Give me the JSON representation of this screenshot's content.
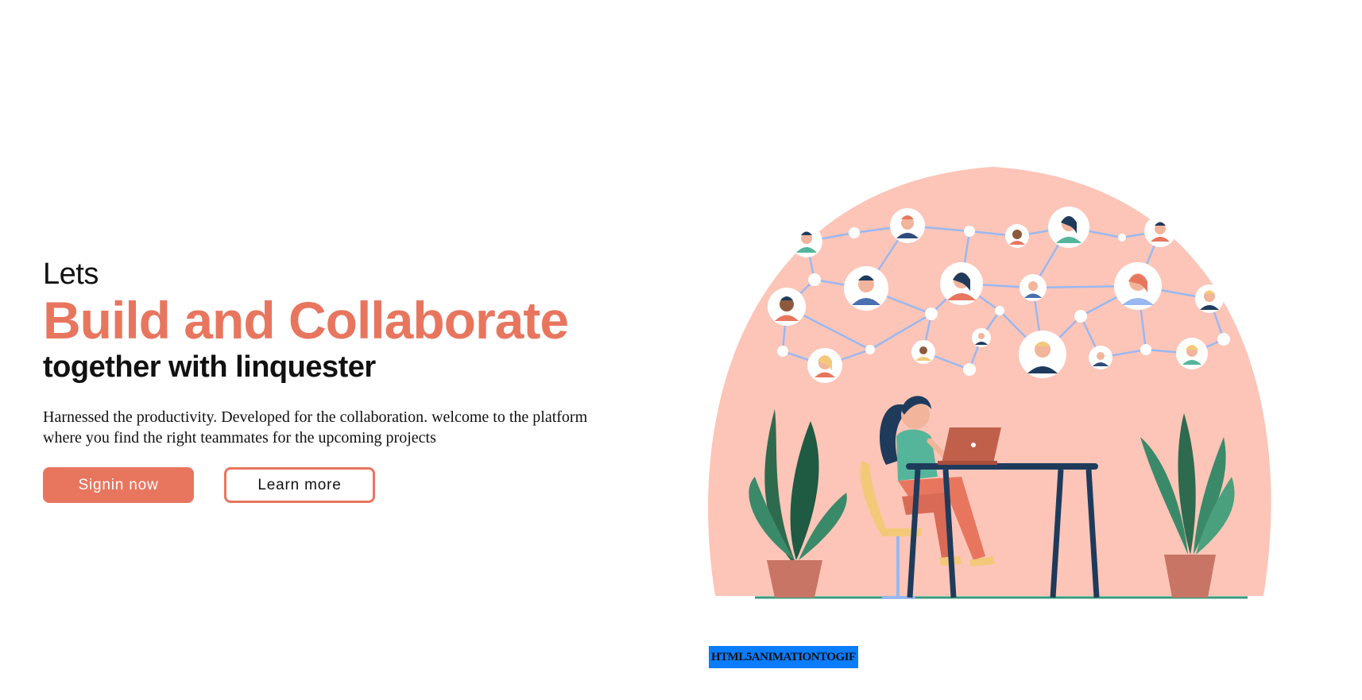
{
  "hero": {
    "heading_lets": "Lets",
    "heading_main": "Build and Collaborate",
    "heading_sub": "together with linquester",
    "description": "Harnessed the productivity. Developed for the collaboration. welcome to the platform where you find the right teammates for the upcoming projects",
    "signin_label": "Signin now",
    "learn_more_label": "Learn more"
  },
  "illustration": {
    "icon": "team-collaboration-illustration",
    "accent_color": "#e8765f",
    "background_blob_color": "#fcc5b8"
  },
  "badge": {
    "label": "HTML5ANIMATIONTOGIF",
    "color": "#0a7cff"
  }
}
